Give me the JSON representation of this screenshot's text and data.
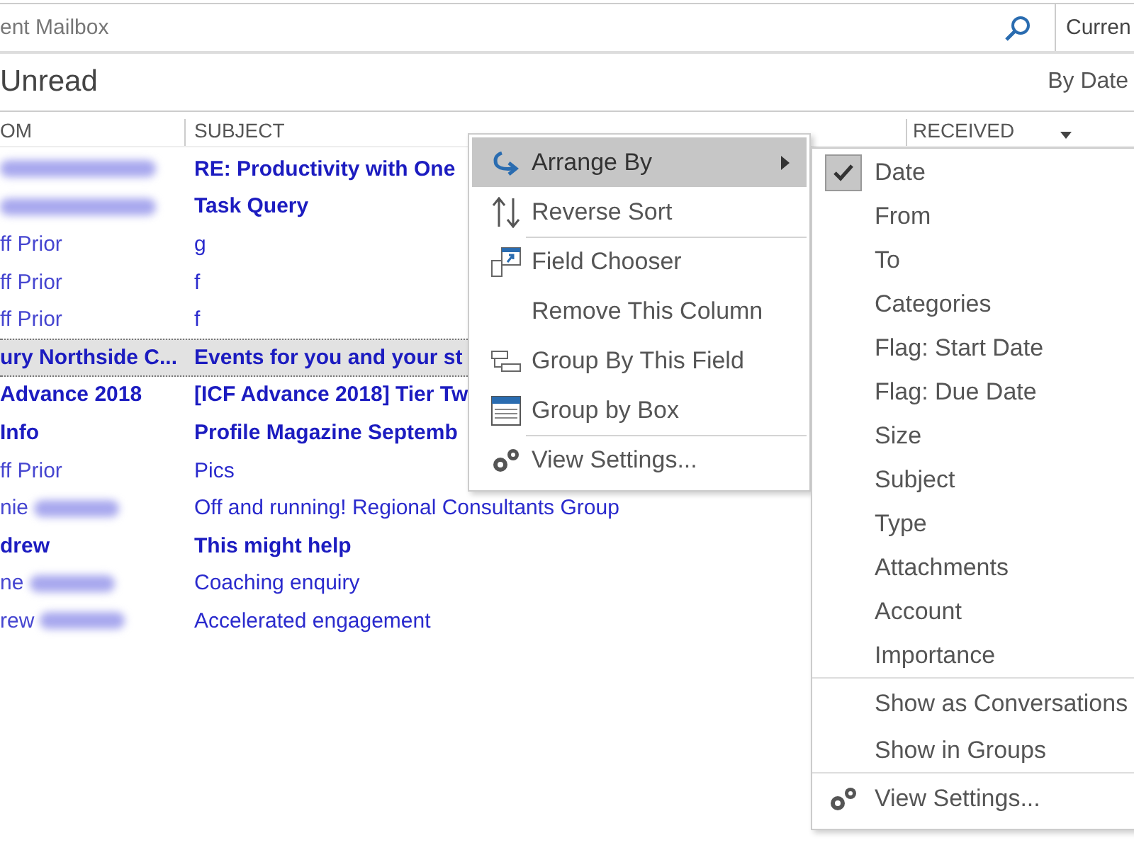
{
  "search_bar": {
    "placeholder": "ent Mailbox",
    "scope": "Curren"
  },
  "filter": {
    "label": "Unread",
    "arrangement": "By Date"
  },
  "columns": [
    {
      "label": "OM"
    },
    {
      "label": "SUBJECT"
    },
    {
      "label": "RECEIVED"
    }
  ],
  "rows": [
    {
      "from": "",
      "subject": "RE: Productivity with One",
      "unread": true,
      "selected": false
    },
    {
      "from": "",
      "subject": "Task Query",
      "unread": true,
      "selected": false
    },
    {
      "from": "ff Prior",
      "subject": "g",
      "unread": false,
      "selected": false
    },
    {
      "from": "ff Prior",
      "subject": "f",
      "unread": false,
      "selected": false
    },
    {
      "from": "ff Prior",
      "subject": "f",
      "unread": false,
      "selected": false
    },
    {
      "from": "ury Northside C...",
      "subject": "Events for you and your st",
      "unread": true,
      "selected": true
    },
    {
      "from": "Advance 2018",
      "subject": "[ICF Advance 2018] Tier Tw",
      "unread": true,
      "selected": false
    },
    {
      "from": "Info",
      "subject": "Profile Magazine Septemb",
      "unread": true,
      "selected": false
    },
    {
      "from": "ff Prior",
      "subject": "Pics",
      "unread": false,
      "selected": false
    },
    {
      "from": "nie",
      "subject": "Off and running! Regional Consultants Group",
      "unread": false,
      "selected": false
    },
    {
      "from": "drew",
      "subject": "This might help",
      "unread": true,
      "selected": false
    },
    {
      "from": "ne",
      "subject": "Coaching enquiry",
      "unread": false,
      "selected": false
    },
    {
      "from": "rew",
      "subject": "Accelerated engagement",
      "unread": false,
      "selected": false
    }
  ],
  "context_menu": [
    {
      "label": "Arrange By",
      "submenu": true,
      "highlighted": true,
      "separator_before": false
    },
    {
      "label": "Reverse Sort",
      "submenu": false,
      "highlighted": false,
      "separator_before": false
    },
    {
      "label": "Field Chooser",
      "submenu": false,
      "highlighted": false,
      "separator_before": true
    },
    {
      "label": "Remove This Column",
      "submenu": false,
      "highlighted": false,
      "separator_before": false
    },
    {
      "label": "Group By This Field",
      "submenu": false,
      "highlighted": false,
      "separator_before": false
    },
    {
      "label": "Group by Box",
      "submenu": false,
      "highlighted": false,
      "separator_before": false
    },
    {
      "label": "View Settings...",
      "submenu": false,
      "highlighted": false,
      "separator_before": true
    }
  ],
  "arrange_submenu": [
    {
      "label": "Date",
      "checked": true,
      "separator_before": false
    },
    {
      "label": "From",
      "checked": false,
      "separator_before": false
    },
    {
      "label": "To",
      "checked": false,
      "separator_before": false
    },
    {
      "label": "Categories",
      "checked": false,
      "separator_before": false
    },
    {
      "label": "Flag: Start Date",
      "checked": false,
      "separator_before": false
    },
    {
      "label": "Flag: Due Date",
      "checked": false,
      "separator_before": false
    },
    {
      "label": "Size",
      "checked": false,
      "separator_before": false
    },
    {
      "label": "Subject",
      "checked": false,
      "separator_before": false
    },
    {
      "label": "Type",
      "checked": false,
      "separator_before": false
    },
    {
      "label": "Attachments",
      "checked": false,
      "separator_before": false
    },
    {
      "label": "Account",
      "checked": false,
      "separator_before": false
    },
    {
      "label": "Importance",
      "checked": false,
      "separator_before": false
    },
    {
      "label": "Show as Conversations",
      "checked": false,
      "separator_before": true
    },
    {
      "label": "Show in Groups",
      "checked": false,
      "separator_before": false
    },
    {
      "label": "View Settings...",
      "checked": false,
      "separator_before": true
    }
  ]
}
